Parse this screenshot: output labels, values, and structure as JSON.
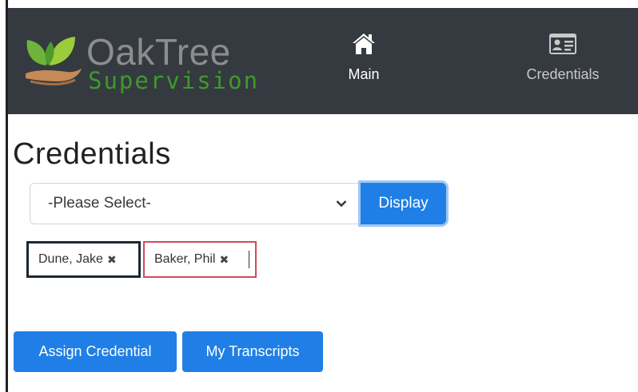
{
  "brand": {
    "name": "OakTree",
    "subtitle": "Supervision",
    "logo_icon": "leaf-hand-icon"
  },
  "nav": {
    "main": {
      "label": "Main",
      "icon": "home-icon"
    },
    "credentials": {
      "label": "Credentials",
      "icon": "id-card-icon"
    }
  },
  "page": {
    "title": "Credentials"
  },
  "filter": {
    "select_value": "-Please Select-",
    "display_label": "Display"
  },
  "tags": [
    {
      "label": "Dune, Jake",
      "remove_icon": "close-icon"
    },
    {
      "label": "Baker, Phil",
      "remove_icon": "close-icon"
    }
  ],
  "actions": {
    "assign_label": "Assign Credential",
    "transcripts_label": "My Transcripts"
  },
  "colors": {
    "navbar": "#343a40",
    "primary": "#1f7fe6",
    "brand_green": "#3e9a2a",
    "focus_red": "#d24a5f"
  }
}
